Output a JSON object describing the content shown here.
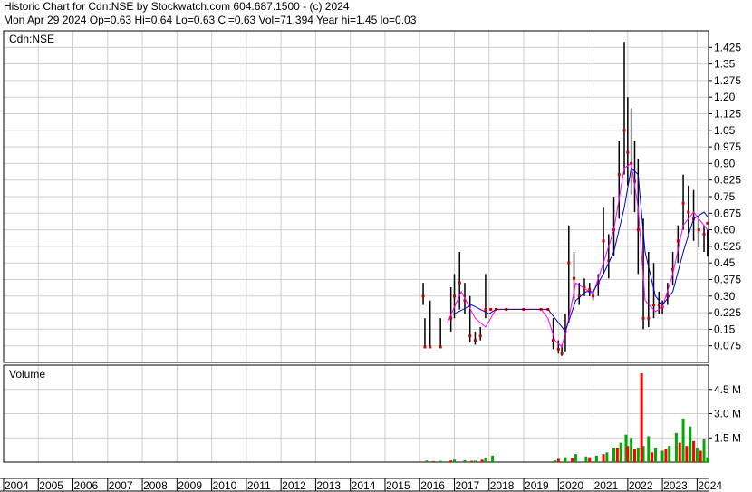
{
  "header": {
    "line1": "Historic Chart for Cdn:NSE by Stockwatch.com 604.687.1500 - (c) 2024",
    "line2": "Mon Apr 29 2024   Op=0.63  Hi=0.64  Lo=0.63  Cl=0.63  Vol=71,394  Year hi=1.45  lo=0.03"
  },
  "chart_data": [
    {
      "type": "line",
      "legend": "Cdn:NSE",
      "xlim": [
        2004,
        2024.33
      ],
      "ylim": [
        0,
        1.5
      ],
      "y_ticks": [
        0.075,
        0.15,
        0.225,
        0.3,
        0.375,
        0.45,
        0.525,
        0.6,
        0.675,
        0.75,
        0.825,
        0.9,
        0.975,
        1.05,
        1.125,
        1.2,
        1.275,
        1.35,
        1.425
      ],
      "y_tick_labels": [
        "0.075",
        "0.15",
        "0.225",
        "0.30",
        "0.375",
        "0.45",
        "0.525",
        "0.60",
        "0.675",
        "0.75",
        "0.825",
        "0.90",
        "0.975",
        "1.05",
        "1.125",
        "1.20",
        "1.275",
        "1.35",
        "1.425"
      ],
      "grid": true,
      "series": [
        {
          "role": "price-high-low",
          "color": "#000000",
          "x": [
            2016.1,
            2016.15,
            2016.3,
            2016.6,
            2016.9,
            2017.0,
            2017.15,
            2017.3,
            2017.45,
            2017.6,
            2017.75,
            2017.9,
            2018.05,
            2018.2,
            2018.5,
            2019.0,
            2019.5,
            2019.7,
            2019.85,
            2020.0,
            2020.1,
            2020.2,
            2020.3,
            2020.45,
            2020.6,
            2020.75,
            2020.9,
            2021.0,
            2021.15,
            2021.3,
            2021.45,
            2021.6,
            2021.75,
            2021.9,
            2022.0,
            2022.1,
            2022.2,
            2022.3,
            2022.45,
            2022.6,
            2022.75,
            2022.9,
            2023.0,
            2023.15,
            2023.3,
            2023.45,
            2023.6,
            2023.75,
            2023.9,
            2024.05,
            2024.2,
            2024.3
          ],
          "high": [
            0.36,
            0.2,
            0.28,
            0.2,
            0.34,
            0.4,
            0.5,
            0.36,
            0.3,
            0.14,
            0.16,
            0.4,
            0.24,
            0.24,
            0.24,
            0.24,
            0.24,
            0.24,
            0.2,
            0.1,
            0.08,
            0.22,
            0.62,
            0.5,
            0.36,
            0.38,
            0.36,
            0.32,
            0.4,
            0.7,
            0.58,
            0.75,
            1.0,
            1.45,
            1.2,
            1.15,
            1.0,
            0.92,
            0.65,
            0.5,
            0.45,
            0.32,
            0.28,
            0.36,
            0.5,
            0.62,
            0.85,
            0.8,
            0.78,
            0.65,
            0.62,
            0.6
          ],
          "low": [
            0.26,
            0.07,
            0.07,
            0.07,
            0.14,
            0.2,
            0.24,
            0.22,
            0.09,
            0.08,
            0.1,
            0.2,
            0.24,
            0.24,
            0.24,
            0.24,
            0.24,
            0.24,
            0.06,
            0.04,
            0.03,
            0.05,
            0.18,
            0.28,
            0.26,
            0.3,
            0.3,
            0.28,
            0.3,
            0.4,
            0.38,
            0.48,
            0.65,
            0.85,
            0.8,
            0.76,
            0.68,
            0.4,
            0.15,
            0.16,
            0.2,
            0.22,
            0.22,
            0.26,
            0.35,
            0.45,
            0.6,
            0.58,
            0.55,
            0.52,
            0.5,
            0.48
          ]
        },
        {
          "role": "price-close",
          "color": "#cc0000",
          "x": [
            2016.1,
            2016.15,
            2016.3,
            2016.6,
            2016.9,
            2017.0,
            2017.15,
            2017.3,
            2017.45,
            2017.6,
            2017.75,
            2017.9,
            2018.05,
            2018.2,
            2018.5,
            2019.0,
            2019.5,
            2019.7,
            2019.85,
            2020.0,
            2020.1,
            2020.2,
            2020.3,
            2020.45,
            2020.6,
            2020.75,
            2020.9,
            2021.0,
            2021.15,
            2021.3,
            2021.45,
            2021.6,
            2021.75,
            2021.9,
            2022.0,
            2022.1,
            2022.2,
            2022.3,
            2022.45,
            2022.6,
            2022.75,
            2022.9,
            2023.0,
            2023.15,
            2023.3,
            2023.45,
            2023.6,
            2023.75,
            2023.9,
            2024.05,
            2024.2,
            2024.3
          ],
          "values": [
            0.3,
            0.07,
            0.07,
            0.07,
            0.2,
            0.3,
            0.36,
            0.28,
            0.12,
            0.1,
            0.12,
            0.24,
            0.24,
            0.24,
            0.24,
            0.24,
            0.24,
            0.24,
            0.1,
            0.06,
            0.04,
            0.14,
            0.45,
            0.38,
            0.3,
            0.34,
            0.33,
            0.3,
            0.36,
            0.55,
            0.46,
            0.6,
            0.85,
            1.05,
            0.95,
            0.9,
            0.82,
            0.6,
            0.2,
            0.2,
            0.26,
            0.26,
            0.25,
            0.3,
            0.42,
            0.55,
            0.72,
            0.68,
            0.65,
            0.6,
            0.58,
            0.63
          ]
        },
        {
          "role": "moving-average-short",
          "color": "#ff00ff",
          "x": [
            2016.8,
            2017.2,
            2017.6,
            2017.9,
            2018.2,
            2019.5,
            2019.7,
            2019.9,
            2020.1,
            2020.3,
            2020.5,
            2020.8,
            2021.0,
            2021.3,
            2021.6,
            2021.9,
            2022.1,
            2022.3,
            2022.5,
            2022.8,
            2023.0,
            2023.3,
            2023.6,
            2023.9,
            2024.2,
            2024.3
          ],
          "values": [
            0.18,
            0.32,
            0.2,
            0.16,
            0.24,
            0.24,
            0.2,
            0.1,
            0.07,
            0.2,
            0.36,
            0.33,
            0.31,
            0.45,
            0.6,
            0.88,
            0.9,
            0.7,
            0.28,
            0.23,
            0.25,
            0.4,
            0.62,
            0.68,
            0.62,
            0.6
          ]
        },
        {
          "role": "moving-average-long",
          "color": "#0000cc",
          "x": [
            2017.0,
            2017.5,
            2018.0,
            2018.2,
            2019.7,
            2019.9,
            2020.2,
            2020.5,
            2020.8,
            2021.0,
            2021.3,
            2021.6,
            2021.9,
            2022.1,
            2022.3,
            2022.5,
            2022.8,
            2023.0,
            2023.3,
            2023.6,
            2023.9,
            2024.2,
            2024.3
          ],
          "values": [
            0.22,
            0.26,
            0.22,
            0.24,
            0.24,
            0.2,
            0.14,
            0.28,
            0.32,
            0.32,
            0.4,
            0.5,
            0.7,
            0.88,
            0.85,
            0.5,
            0.3,
            0.26,
            0.32,
            0.5,
            0.65,
            0.68,
            0.66
          ]
        }
      ]
    },
    {
      "type": "bar",
      "legend": "Volume",
      "ylim": [
        0,
        6000000
      ],
      "y_ticks": [
        1500000,
        3000000,
        4500000
      ],
      "y_tick_labels": [
        "1.5 M",
        "3.0 M",
        "4.5 M"
      ],
      "grid": true,
      "x_ticks": [
        2004,
        2005,
        2006,
        2007,
        2008,
        2009,
        2010,
        2011,
        2012,
        2013,
        2014,
        2015,
        2016,
        2017,
        2018,
        2019,
        2020,
        2021,
        2022,
        2023,
        2024
      ],
      "x_tick_labels": [
        "2004",
        "2005",
        "2006",
        "2007",
        "2008",
        "2009",
        "2010",
        "2011",
        "2012",
        "2013",
        "2014",
        "2015",
        "2016",
        "2017",
        "2018",
        "2019",
        "2020",
        "2021",
        "2022",
        "2023",
        "2024"
      ],
      "series": [
        {
          "name": "",
          "color": "#00aa00",
          "x": [
            2016.2,
            2016.6,
            2017.0,
            2017.3,
            2017.6,
            2017.9,
            2018.1,
            2019.9,
            2020.2,
            2020.5,
            2020.8,
            2021.1,
            2021.4,
            2021.6,
            2021.8,
            2021.95,
            2022.1,
            2022.3,
            2022.45,
            2022.6,
            2022.8,
            2023.0,
            2023.2,
            2023.4,
            2023.6,
            2023.8,
            2024.0,
            2024.2,
            2024.3
          ],
          "values": [
            100000,
            80000,
            150000,
            120000,
            90000,
            250000,
            400000,
            100000,
            300000,
            500000,
            350000,
            400000,
            600000,
            900000,
            1200000,
            1700000,
            1500000,
            900000,
            1000000,
            1600000,
            900000,
            700000,
            1000000,
            1800000,
            2700000,
            2200000,
            900000,
            1400000,
            300000
          ]
        },
        {
          "name": "",
          "color": "#ff0000",
          "x": [
            2016.4,
            2016.9,
            2017.5,
            2017.8,
            2020.0,
            2020.4,
            2020.9,
            2021.3,
            2021.7,
            2022.0,
            2022.2,
            2022.4,
            2022.7,
            2023.1,
            2023.5,
            2023.7,
            2023.9,
            2024.1
          ],
          "values": [
            60000,
            100000,
            80000,
            150000,
            200000,
            250000,
            300000,
            500000,
            900000,
            1000000,
            800000,
            5500000,
            600000,
            800000,
            1200000,
            1000000,
            1300000,
            700000
          ]
        }
      ]
    }
  ]
}
